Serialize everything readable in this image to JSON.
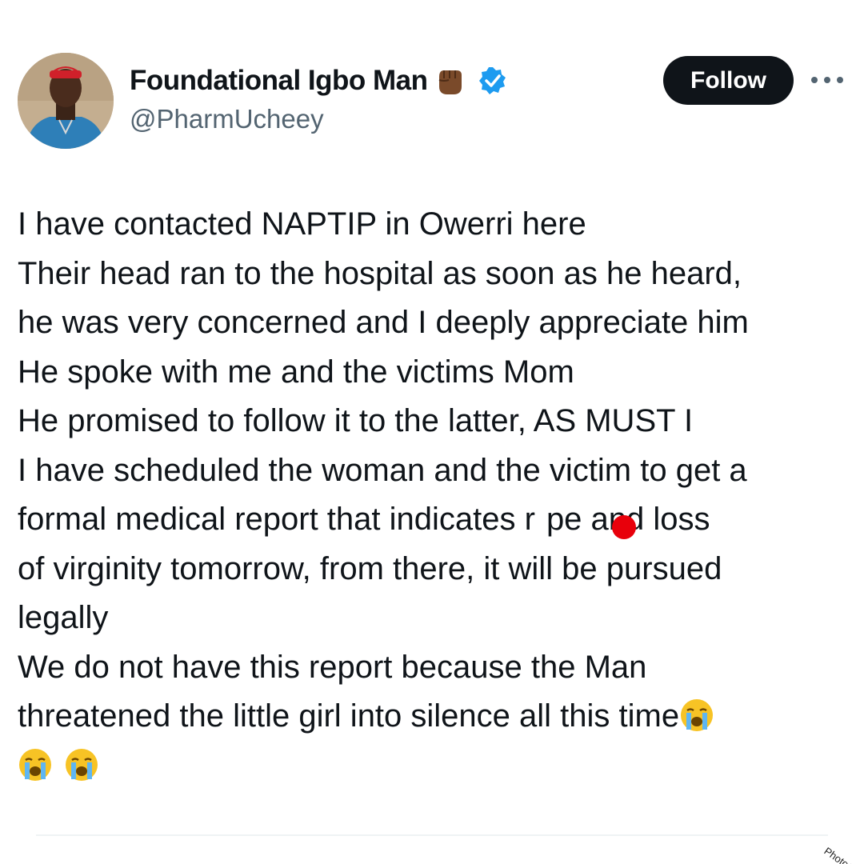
{
  "tweet": {
    "author": {
      "display_name": "Foundational Igbo Man",
      "handle": "@PharmUcheey",
      "name_emoji": "raised-fist-icon",
      "verified": true,
      "verified_color": "#1d9bf0"
    },
    "follow_label": "Follow",
    "more_icon": "more-horizontal-icon",
    "lines": [
      "I have contacted NAPTIP in Owerri here",
      "Their head ran to the hospital as soon as he heard,",
      "he was very concerned and I deeply appreciate him",
      "He spoke with me and the victims Mom",
      "He promised to follow it to the latter, AS MUST I",
      "I have scheduled the woman and the victim to get a",
      "formal medical report that indicates r",
      "pe and loss",
      "of virginity tomorrow, from there, it will be pursued",
      "legally",
      "We do not have this report because the Man",
      "threatened the little girl into silence all this time"
    ],
    "trailing_emojis": [
      "loudly-crying-face-icon",
      "loudly-crying-face-icon",
      "loudly-crying-face-icon"
    ]
  },
  "watermark": "PhotoG",
  "colors": {
    "text": "#0f1419",
    "secondary": "#536471",
    "button_bg": "#0f1419",
    "button_text": "#ffffff",
    "redaction_dot": "#e8000b"
  }
}
